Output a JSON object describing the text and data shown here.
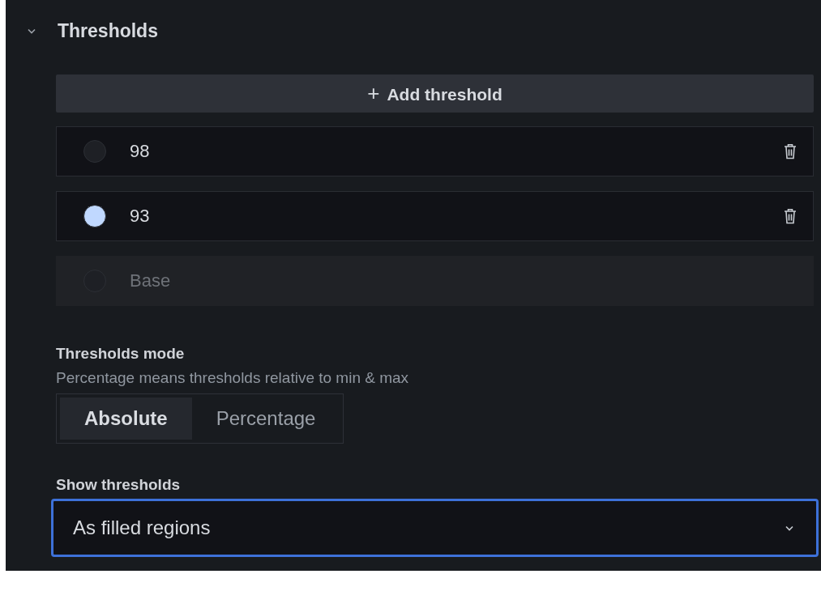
{
  "section": {
    "title": "Thresholds",
    "expanded": true
  },
  "add_button": {
    "label": "Add threshold",
    "icon_text": "+"
  },
  "thresholds": [
    {
      "value": "98",
      "color": "#1e2025",
      "disabled": false,
      "deletable": true
    },
    {
      "value": "93",
      "color": "#c0d8ff",
      "disabled": false,
      "deletable": true
    },
    {
      "value": "Base",
      "color": "#1e2025",
      "disabled": true,
      "deletable": false
    }
  ],
  "mode": {
    "label": "Thresholds mode",
    "description": "Percentage means thresholds relative to min & max",
    "options": [
      {
        "label": "Absolute",
        "selected": true
      },
      {
        "label": "Percentage",
        "selected": false
      }
    ]
  },
  "show_thresholds": {
    "label": "Show thresholds",
    "value": "As filled regions",
    "focused": true
  }
}
